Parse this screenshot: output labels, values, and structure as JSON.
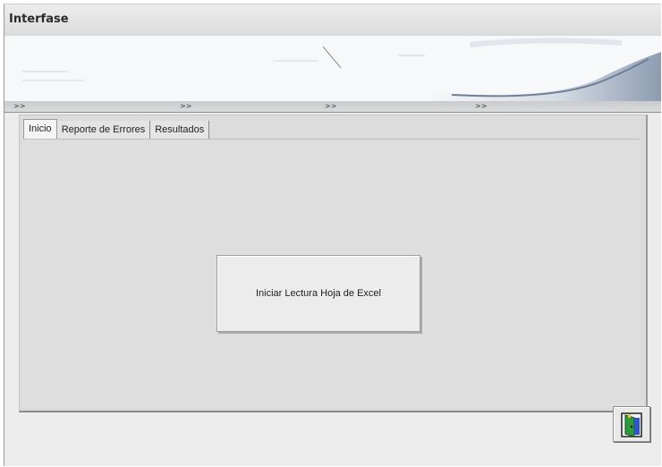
{
  "window": {
    "title": "Interfase"
  },
  "nav_strip": {
    "markers": [
      ">>",
      ">>",
      ">>",
      ">>"
    ]
  },
  "tabs": [
    {
      "label": "Inicio",
      "active": true
    },
    {
      "label": "Reporte de Errores",
      "active": false
    },
    {
      "label": "Resultados",
      "active": false
    }
  ],
  "main": {
    "start_button_label": "Iniciar Lectura Hoja de Excel"
  },
  "footer": {
    "exit_icon": "exit-door-icon"
  },
  "colors": {
    "panel": "#dedede",
    "banner_accent": "#a9b4c6"
  }
}
